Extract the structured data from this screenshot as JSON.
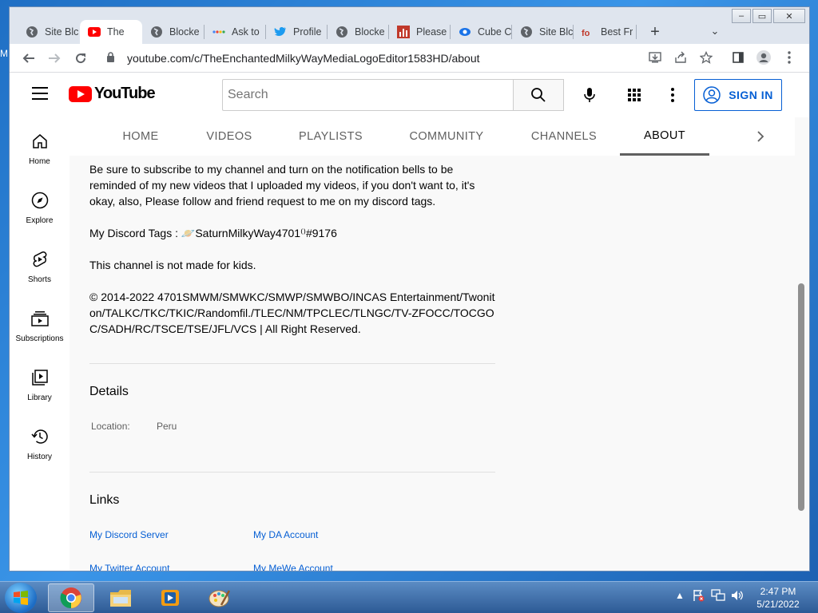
{
  "desktop": {
    "edge_text": "M"
  },
  "browser": {
    "tabs": [
      {
        "label": "Site Blc",
        "icon": "globe-icon"
      },
      {
        "label": "The",
        "icon": "youtube-icon",
        "active": true
      },
      {
        "label": "Blocke",
        "icon": "globe-icon"
      },
      {
        "label": "Ask to",
        "icon": "dots-icon"
      },
      {
        "label": "Profile",
        "icon": "twitter-icon"
      },
      {
        "label": "Blocke",
        "icon": "globe-icon"
      },
      {
        "label": "Please",
        "icon": "bar-chart-icon"
      },
      {
        "label": "Cube C",
        "icon": "cube-icon"
      },
      {
        "label": "Site Blc",
        "icon": "globe-icon"
      },
      {
        "label": "Best Fr",
        "icon": "font-icon"
      }
    ],
    "url": "youtube.com/c/TheEnchantedMilkyWayMediaLogoEditor1583HD/about",
    "new_tab": "+",
    "controls": {
      "minimize": "–",
      "restore": "▭",
      "close": "✕"
    }
  },
  "youtube": {
    "logo_text": "YouTube",
    "search_placeholder": "Search",
    "sign_in": "SIGN IN",
    "guide": [
      {
        "label": "Home",
        "icon": "home-icon"
      },
      {
        "label": "Explore",
        "icon": "compass-icon"
      },
      {
        "label": "Shorts",
        "icon": "shorts-icon"
      },
      {
        "label": "Subscriptions",
        "icon": "subscriptions-icon"
      },
      {
        "label": "Library",
        "icon": "library-icon"
      },
      {
        "label": "History",
        "icon": "history-icon"
      }
    ],
    "channel_tabs": [
      "HOME",
      "VIDEOS",
      "PLAYLISTS",
      "COMMUNITY",
      "CHANNELS",
      "ABOUT"
    ],
    "active_tab": "ABOUT",
    "partial_tab": "",
    "about": {
      "description": [
        "Be sure to subscribe to my channel and turn on the notification bells to be reminded of my new videos that I uploaded my videos, if you don't want to, it's okay, also, Please follow and friend request to me on my discord tags.",
        "My Discord Tags : 🪐SaturnMilkyWay4701⁽⁾#9176",
        "This channel is not made for kids.",
        "© 2014-2022 4701SMWM/SMWKC/SMWP/SMWBO/INCAS Entertainment/Twoniton/TALKC/TKC/TKIC/Randomfil./TLEC/NM/TPCLEC/TLNGC/TV-ZFOCC/TOCGOC/SADH/RC/TSCE/TSE/JFL/VCS | All Right Reserved."
      ],
      "details_title": "Details",
      "location_label": "Location:",
      "location_value": "Peru",
      "links_title": "Links",
      "links": [
        "My Discord Server",
        "My DA Account",
        "My Twitter Account",
        "My MeWe Account"
      ]
    }
  },
  "taskbar": {
    "time": "2:47 PM",
    "date": "5/21/2022",
    "apps": [
      "chrome-icon",
      "explorer-icon",
      "media-player-icon",
      "paint-icon"
    ]
  }
}
